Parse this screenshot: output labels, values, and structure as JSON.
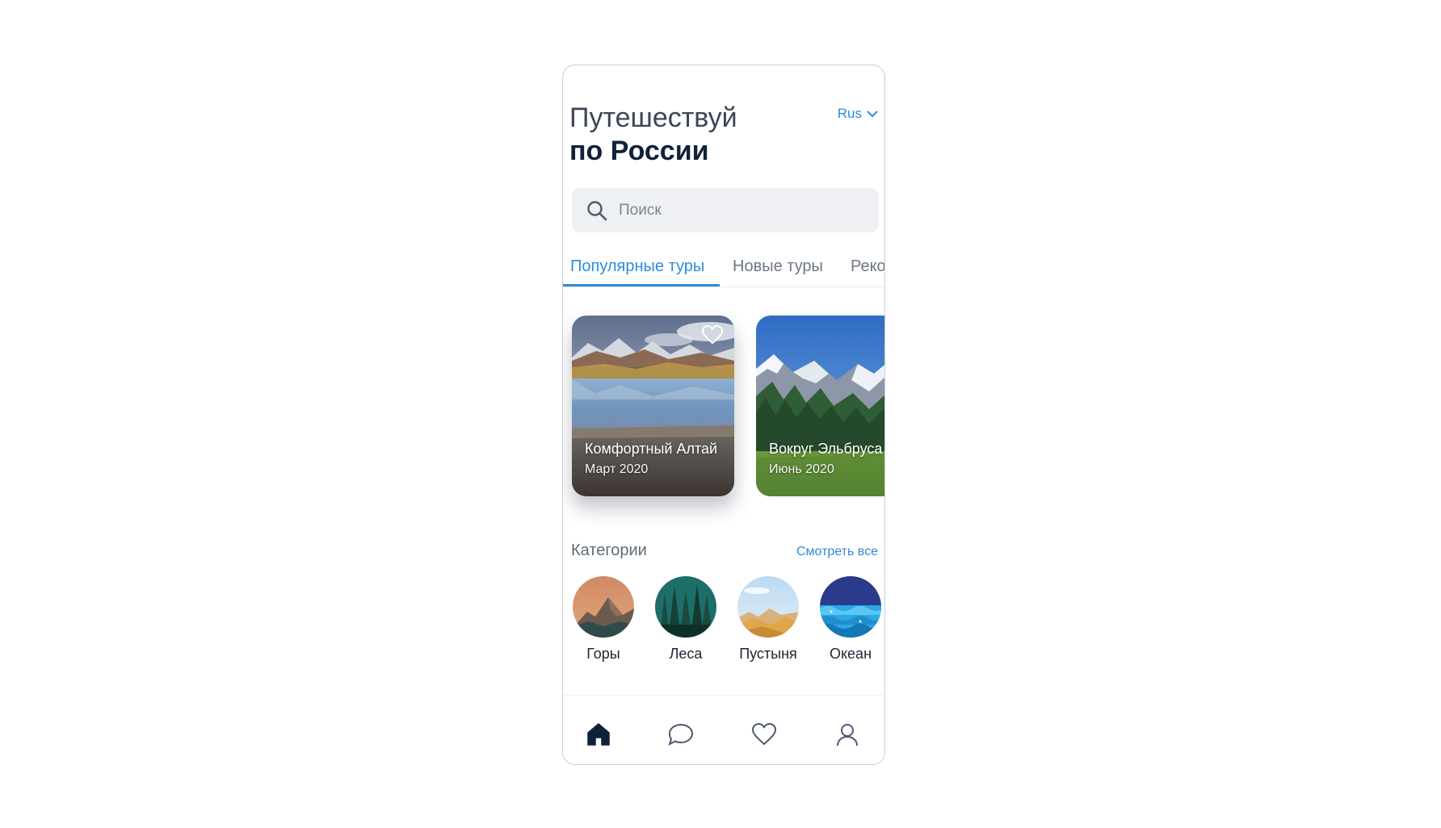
{
  "header": {
    "title_line1": "Путешествуй",
    "title_line2": "по России"
  },
  "language": {
    "current": "Rus"
  },
  "search": {
    "placeholder": "Поиск",
    "value": ""
  },
  "tabs": [
    {
      "label": "Популярные туры",
      "active": true
    },
    {
      "label": "Новые туры",
      "active": false
    },
    {
      "label": "Реко",
      "active": false
    }
  ],
  "tours": [
    {
      "title": "Комфортный Алтай",
      "date": "Март 2020",
      "icon": "heart-icon"
    },
    {
      "title": "Вокруг Эльбруса",
      "date": "Июнь 2020"
    }
  ],
  "categories": {
    "heading": "Категории",
    "see_all": "Смотреть все",
    "items": [
      {
        "label": "Горы"
      },
      {
        "label": "Леса"
      },
      {
        "label": "Пустыня"
      },
      {
        "label": "Океан"
      }
    ]
  },
  "bottom_nav": [
    {
      "icon": "home-icon",
      "active": true
    },
    {
      "icon": "chat-icon",
      "active": false
    },
    {
      "icon": "heart-icon",
      "active": false
    },
    {
      "icon": "profile-icon",
      "active": false
    }
  ],
  "colors": {
    "accent": "#2f8bd8",
    "nav_active": "#0f2238",
    "nav_inactive": "#4a5a70"
  }
}
